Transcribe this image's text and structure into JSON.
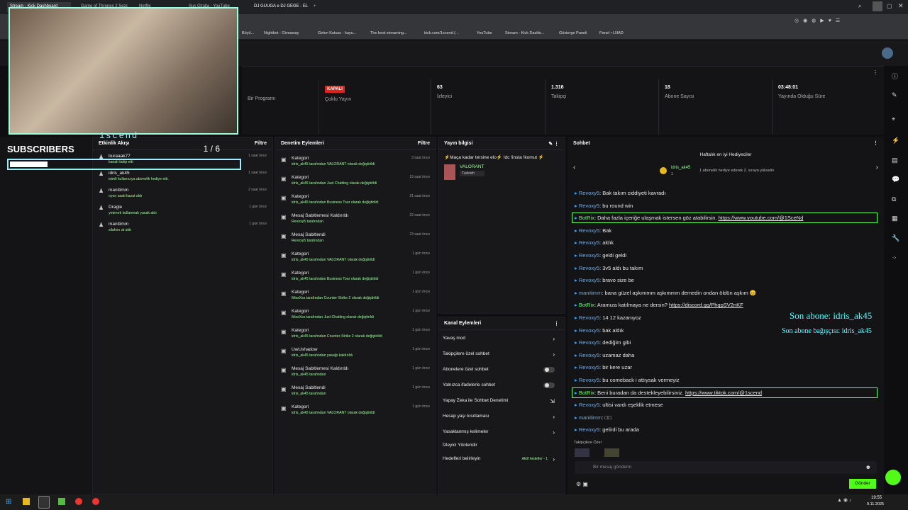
{
  "browser": {
    "tabs": [
      "Stream - Kick Dashboard",
      "Game of Thrones 2 Sezon",
      "Netflix",
      "Netflix",
      "Sus Ozalla - YouTube",
      "DJ GUUGA e DJ GEGE - EL..."
    ],
    "new_tab": "+"
  },
  "bookmarks": [
    "Büyü...",
    "Nightbot - Giveaway",
    "Gelen Kutusu - kayu...",
    "The best streaming...",
    "kick.com/1scend (...",
    "YouTube",
    "Stream - Kick Dashb...",
    "Gösterge Paneli",
    "Panel • LNAD"
  ],
  "webcam": {
    "label": "1scend"
  },
  "subs_widget": {
    "title": "SUBSCRIBERS",
    "count": "1 / 6",
    "progress": 0.1667
  },
  "stats": [
    {
      "value": "",
      "label": "Bir Programı"
    },
    {
      "value": "KAPALI",
      "label": "Çoklu Yayın"
    },
    {
      "value": "63",
      "label": "İzleyici"
    },
    {
      "value": "1.316",
      "label": "Takipçi"
    },
    {
      "value": "18",
      "label": "Abone Sayısı"
    },
    {
      "value": "03:48:01",
      "label": "Yayında Olduğu Süre"
    }
  ],
  "activity": {
    "title": "Etkinlik Akışı",
    "filter": "Filtre",
    "items": [
      {
        "user": "buraaak77",
        "text": "kanalı takip etti",
        "time": "1 saat önce"
      },
      {
        "user": "idris_ak45",
        "text": "isimli kullanıcıya abonelik hediye etti.",
        "time": "1 saat önce"
      },
      {
        "user": "manitimm",
        "text": "oyun saati kazat aldı",
        "time": "2 saat önce"
      },
      {
        "user": "Dragle",
        "text": "yetenek kullanmak yasak aldı",
        "time": "1 gün önce"
      },
      {
        "user": "manitimm",
        "text": "silahını at aldı",
        "time": "1 gün önce"
      }
    ]
  },
  "moderation": {
    "title": "Denetim Eylemleri",
    "filter": "Filtre",
    "items": [
      {
        "title": "Kategori",
        "sub": "idris_ak45 tarafından VALORANT olarak değiştirildi",
        "time": "3 saat önce"
      },
      {
        "title": "Kategori",
        "sub": "idris_ak45 tarafından Just Chatting olarak değiştirildi",
        "time": "19 saat önce"
      },
      {
        "title": "Kategori",
        "sub": "idris_ak45 tarafından Business Tour olarak değiştirildi",
        "time": "21 saat önce"
      },
      {
        "title": "Mesaj Sabitlemesi Kaldırıldı",
        "sub": "Revoxy5 tarafından",
        "time": "22 saat önce"
      },
      {
        "title": "Mesaj Sabitlendi",
        "sub": "Revoxy5 tarafından",
        "time": "23 saat önce"
      },
      {
        "title": "Kategori",
        "sub": "idris_ak45 tarafından VALORANT olarak değiştirildi",
        "time": "1 gün önce"
      },
      {
        "title": "Kategori",
        "sub": "idris_ak45 tarafından Business Tour olarak değiştirildi",
        "time": "1 gün önce"
      },
      {
        "title": "Kategori",
        "sub": "MissXss tarafından Counter-Strike 2 olarak değiştirildi",
        "time": "1 gün önce"
      },
      {
        "title": "Kategori",
        "sub": "MissXss tarafından Just Chatting olarak değiştirildi",
        "time": "1 gün önce"
      },
      {
        "title": "Kategori",
        "sub": "idris_ak45 tarafından Counter-Strike 2 olarak değiştirildi",
        "time": "1 gün önce"
      },
      {
        "title": "UwUshadow",
        "sub": "idris_ak45 tarafından yasağı kaldırıldı",
        "time": "1 gün önce"
      },
      {
        "title": "Mesaj Sabitlemesi Kaldırıldı",
        "sub": "idris_ak45 tarafından",
        "time": "1 gün önce"
      },
      {
        "title": "Mesaj Sabitlendi",
        "sub": "idris_ak45 tarafından",
        "time": "1 gün önce"
      },
      {
        "title": "Kategori",
        "sub": "idris_ak45 tarafından VALORANT olarak değiştirildi",
        "time": "1 gün önce"
      }
    ]
  },
  "stream_info": {
    "title": "Yayın bilgisi",
    "stream_title": "⚡Maça kadar tersine elo⚡ !dc !insta !komut ⚡",
    "category": "VALORANT",
    "language": "Turkish"
  },
  "channel_actions": {
    "title": "Kanal Eylemleri",
    "items": [
      "Yavaş mod",
      "Takipçilere özel sohbet",
      "Abonelere özel sohbet",
      "Yalnızca ifadelerle sohbet",
      "Yapay Zeka ile Sohbet Denetimi",
      "Hesap yaşı kısıtlaması",
      "Yasaklanmış kelimeler",
      "İzleyici Yönlendir",
      "Hedefleri belirleyin"
    ],
    "goals_status": "Aktif hedefler - 1"
  },
  "chat": {
    "title": "Sohbet",
    "gifters_title": "Haftalık en iyi Hediyeciler",
    "gifter": "idris_ak45",
    "gifter_count": "1",
    "gifter_hint": "1 abonelik hediye ederek 2. sıraya yükselin",
    "followers_label": "Takipçilere Özel",
    "input_placeholder": "Bir mesaj gönderin",
    "send": "Gönder",
    "messages": [
      {
        "user": "Revoxy5",
        "text": "Bak takım ciddiyeti kavradı"
      },
      {
        "user": "Revoxy5",
        "text": "bu round win"
      },
      {
        "user": "BotRix",
        "text": "Daha fazla içeriğe ulaşmak istersen göz atabilirsin.",
        "link": "https://www.youtube.com/@1SceNd",
        "bot": true
      },
      {
        "user": "Revoxy5",
        "text": "Bak"
      },
      {
        "user": "Revoxy5",
        "text": "aldık"
      },
      {
        "user": "Revoxy5",
        "text": "geldi geldi"
      },
      {
        "user": "Revoxy5",
        "text": "3v5 aldı bu takım"
      },
      {
        "user": "Revoxy5",
        "text": "bravo size be"
      },
      {
        "user": "manitimm",
        "text": "bana güzel aşkımmm aşkımmm demedin ondan öldün aşkım 😊"
      },
      {
        "user": "BotRix",
        "text": "Aramıza katılmaya ne dersin?",
        "link": "https://discord.gg/PhqpSV2nKF"
      },
      {
        "user": "Revoxy5",
        "text": "14 12 kazanıyoz"
      },
      {
        "user": "Revoxy5",
        "text": "bak aldık"
      },
      {
        "user": "Revoxy5",
        "text": "dediğim gibi"
      },
      {
        "user": "Revoxy5",
        "text": "uzamaz daha"
      },
      {
        "user": "Revoxy5",
        "text": "bir kere uzar"
      },
      {
        "user": "Revoxy5",
        "text": "bu comeback i attıysak vermeyiz"
      },
      {
        "user": "BotRix",
        "text": "Beni buradan da destekleyebilirsiniz.",
        "link": "https://www.tiktok.com/@1scend",
        "bot": true
      },
      {
        "user": "Revoxy5",
        "text": "ultisi vardı eşeklik etmese"
      },
      {
        "user": "manitimm",
        "text": "□□"
      },
      {
        "user": "Revoxy5",
        "text": "gelirdi bu arada"
      }
    ]
  },
  "overlay": {
    "last_sub": "Son abone: idris_ak45",
    "last_gift": "Son abone bağışçısı: idris_ak45"
  },
  "taskbar": {
    "time": "19:55",
    "date": "9.11.2025"
  }
}
